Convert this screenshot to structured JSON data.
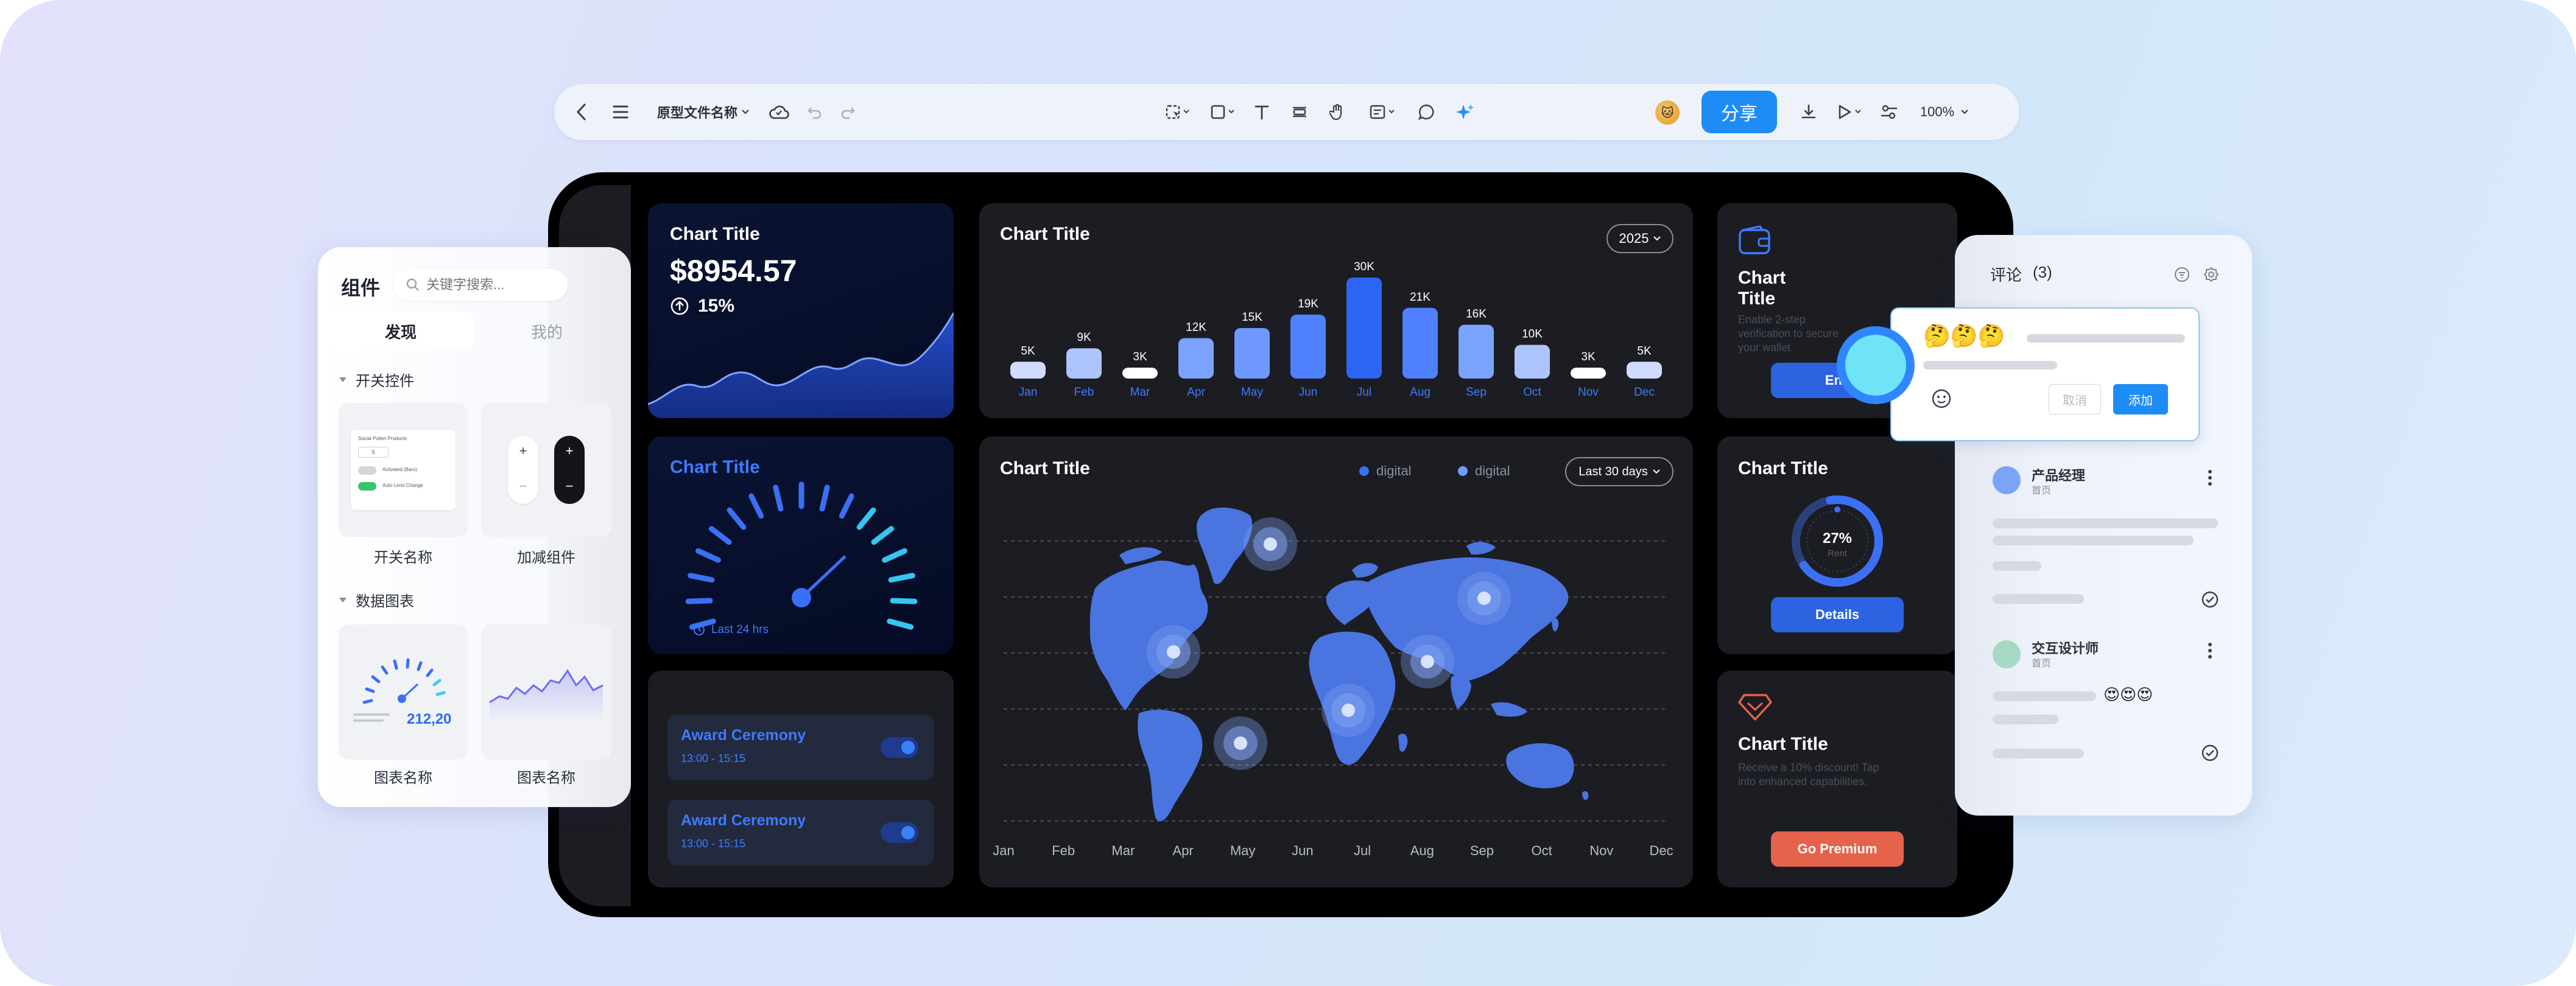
{
  "toolbar": {
    "file_name": "原型文件名称",
    "share_label": "分享",
    "zoom": "100%",
    "avatar_emoji": "🐱"
  },
  "left_panel": {
    "title": "组件",
    "search_placeholder": "关键字搜索...",
    "tabs": [
      "发现",
      "我的"
    ],
    "section1": "开关控件",
    "section1_items": [
      "开关名称",
      "加减组件"
    ],
    "section2": "数据图表",
    "section2_items": [
      "图表名称",
      "图表名称"
    ],
    "switch_thumb": {
      "head": "Social Pollen Products",
      "stepper_value": "5",
      "row1": "Activated (Bars)",
      "row2": "Auto Leno Change"
    },
    "plus": "+",
    "minus": "−",
    "gauge_value": "212,20"
  },
  "dashboard": {
    "balance_card": {
      "title": "Chart Title",
      "amount": "$8954.57",
      "change": "15%"
    },
    "bar_card": {
      "title": "Chart Title",
      "year": "2025"
    },
    "gauge_card": {
      "title": "Chart Title",
      "footer": "Last 24 hrs"
    },
    "events": [
      {
        "name": "Award Ceremony",
        "time": "13:00 - 15:15"
      },
      {
        "name": "Award Ceremony",
        "time": "13:00 - 15:15"
      }
    ],
    "map_card": {
      "title": "Chart Title",
      "legend": [
        "digital",
        "digital"
      ],
      "range": "Last 30 days",
      "months": [
        "Jan",
        "Feb",
        "Mar",
        "Apr",
        "May",
        "Jun",
        "Jul",
        "Aug",
        "Sep",
        "Oct",
        "Nov",
        "Dec"
      ]
    },
    "wallet_card": {
      "title": "Chart Title",
      "desc": "Enable 2-step verification to secure your wallet.",
      "button": "Ena"
    },
    "donut_card": {
      "title": "Chart Title",
      "percent": "27%",
      "sub": "Rent",
      "button": "Details"
    },
    "premium_card": {
      "title": "Chart Title",
      "desc": "Receive a 10% discount! Tap into enhanced capabilities.",
      "button": "Go Premium"
    }
  },
  "comments": {
    "title": "评论",
    "count": "(3)",
    "popup": {
      "emojis": "🤔🤔🤔",
      "cancel": "取消",
      "add": "添加"
    },
    "items": [
      {
        "name": "产品经理",
        "page": "首页"
      },
      {
        "name": "交互设计师",
        "page": "首页",
        "emojis": "😍😍😍"
      }
    ]
  },
  "colors": {
    "accent": "#1e8cf5",
    "bar_blue": "#3b6ff5",
    "premium": "#e5634b"
  },
  "chart_data": {
    "type": "bar",
    "categories": [
      "Jan",
      "Feb",
      "Mar",
      "Apr",
      "May",
      "Jun",
      "Jul",
      "Aug",
      "Sep",
      "Oct",
      "Nov",
      "Dec"
    ],
    "values": [
      5,
      9,
      3,
      12,
      15,
      19,
      30,
      21,
      16,
      10,
      3,
      5
    ],
    "labels": [
      "5K",
      "9K",
      "3K",
      "12K",
      "15K",
      "19K",
      "30K",
      "21K",
      "16K",
      "10K",
      "3K",
      "5K"
    ],
    "title": "Chart Title",
    "ylim": [
      0,
      30
    ]
  }
}
